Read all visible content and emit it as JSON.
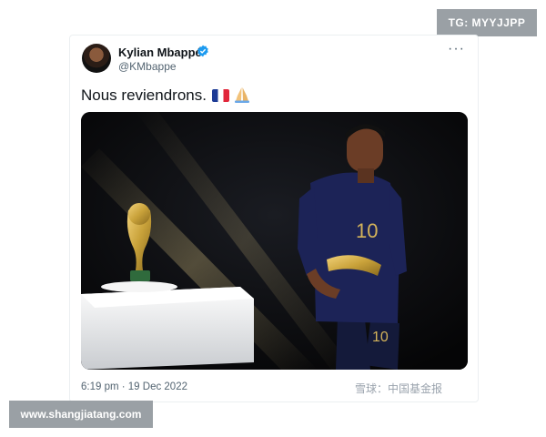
{
  "tweet": {
    "author_name": "Kylian Mbappé",
    "author_handle": "@KMbappe",
    "text": "Nous reviendrons.",
    "emojis": [
      "flag-france-icon",
      "folded-hands-icon"
    ],
    "timestamp": "6:19 pm · 19 Dec 2022",
    "photo_number": "10"
  },
  "watermarks": {
    "top_right": "TG: MYYJJPP",
    "bottom_left": "www.shangjiatang.com",
    "bottom_right": "雪球：中国基金报"
  },
  "colors": {
    "verified_blue": "#1d9bf0",
    "france_blue": "#1d3b96",
    "france_red": "#e1263a",
    "gold": "#c9a23a"
  }
}
